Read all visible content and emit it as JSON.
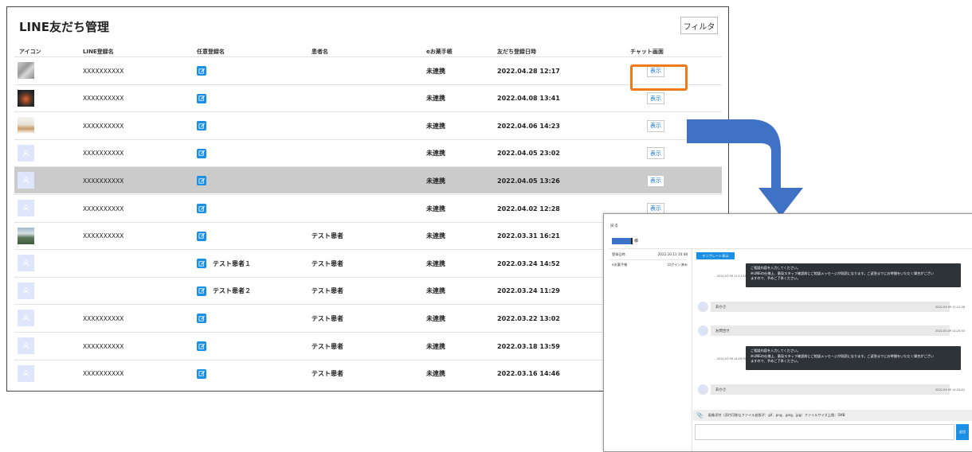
{
  "list": {
    "title": "LINE友だち管理",
    "filter_label": "フィルタ",
    "columns": {
      "icon": "アイコン",
      "line_name": "LINE登録名",
      "custom_name": "任意登録名",
      "patient_name": "患者名",
      "e_okusuri": "eお薬手帳",
      "registered_at": "友だち登録日時",
      "chat": "チャット画面"
    },
    "rows": [
      {
        "avatar": "photo1",
        "line_name": "XXXXXXXXXX",
        "custom_name": "",
        "patient": "",
        "status": "未連携",
        "date": "2022.04.28 12:17",
        "show": "表示"
      },
      {
        "avatar": "photo2",
        "line_name": "XXXXXXXXXX",
        "custom_name": "",
        "patient": "",
        "status": "未連携",
        "date": "2022.04.08 13:41",
        "show": "表示"
      },
      {
        "avatar": "photo3",
        "line_name": "XXXXXXXXXX",
        "custom_name": "",
        "patient": "",
        "status": "未連携",
        "date": "2022.04.06 14:23",
        "show": "表示"
      },
      {
        "avatar": "placeholder",
        "line_name": "XXXXXXXXXX",
        "custom_name": "",
        "patient": "",
        "status": "未連携",
        "date": "2022.04.05 23:02",
        "show": "表示"
      },
      {
        "avatar": "placeholder",
        "line_name": "XXXXXXXXXX",
        "custom_name": "",
        "patient": "",
        "status": "未連携",
        "date": "2022.04.05 13:26",
        "show": "表示"
      },
      {
        "avatar": "placeholder",
        "line_name": "XXXXXXXXXX",
        "custom_name": "",
        "patient": "",
        "status": "未連携",
        "date": "2022.04.02 12:28",
        "show": "表示"
      },
      {
        "avatar": "photo4",
        "line_name": "XXXXXXXXXX",
        "custom_name": "",
        "patient": "テスト患者",
        "status": "未連携",
        "date": "2022.03.31 16:21",
        "show": ""
      },
      {
        "avatar": "placeholder",
        "line_name": "",
        "custom_name": "テスト患者１",
        "patient": "テスト患者",
        "status": "未連携",
        "date": "2022.03.24 14:52",
        "show": ""
      },
      {
        "avatar": "placeholder",
        "line_name": "",
        "custom_name": "テスト患者２",
        "patient": "テスト患者",
        "status": "未連携",
        "date": "2022.03.24 11:29",
        "show": ""
      },
      {
        "avatar": "placeholder",
        "line_name": "XXXXXXXXXX",
        "custom_name": "",
        "patient": "テスト患者",
        "status": "未連携",
        "date": "2022.03.22 13:02",
        "show": ""
      },
      {
        "avatar": "placeholder",
        "line_name": "XXXXXXXXXX",
        "custom_name": "",
        "patient": "テスト患者",
        "status": "未連携",
        "date": "2022.03.18 13:59",
        "show": ""
      },
      {
        "avatar": "placeholder",
        "line_name": "XXXXXXXXXX",
        "custom_name": "",
        "patient": "テスト患者",
        "status": "未連携",
        "date": "2022.03.16 14:46",
        "show": ""
      }
    ],
    "highlighted_row": 4,
    "callout_row": 0
  },
  "chat": {
    "back_label": "戻る",
    "name_suffix": "様",
    "info": [
      {
        "label": "登録日時",
        "value": "2022.10.11 10:48"
      },
      {
        "label": "eお薬手帳",
        "value": "ログイン済み"
      }
    ],
    "template_button": "テンプレート表示",
    "bot_message_lines": [
      "ご相談内容を入力してください。",
      "※LINEの仕様上、薬局スタッフ確認前にご相談メッセージが既読になります。ご返答までにお時間をいただく場合がござい",
      "ますので、予めご了承ください。"
    ],
    "messages": [
      {
        "type": "bot",
        "time": "2022.03.09 11:11:52"
      },
      {
        "type": "user",
        "text": "あかさ",
        "time": "2022.03.09 11:12:36"
      },
      {
        "type": "user",
        "text": "お問合せ",
        "time": "2022.03.09 14:25:30"
      },
      {
        "type": "bot",
        "time": "2022.03.09 14:25:30"
      },
      {
        "type": "user",
        "text": "あかさ",
        "time": "2022.03.09 14:25:42"
      }
    ],
    "attach_text": "画像添付（添付可能なファイル拡張子：gif、png、jpeg、jpg）ファイルサイズ上限：5MB",
    "send_label": "送信"
  },
  "colors": {
    "accent": "#1a8fe3",
    "callout": "#f07a1a",
    "arrow": "#3f72c4",
    "highlight_row": "#cbcbcb"
  }
}
